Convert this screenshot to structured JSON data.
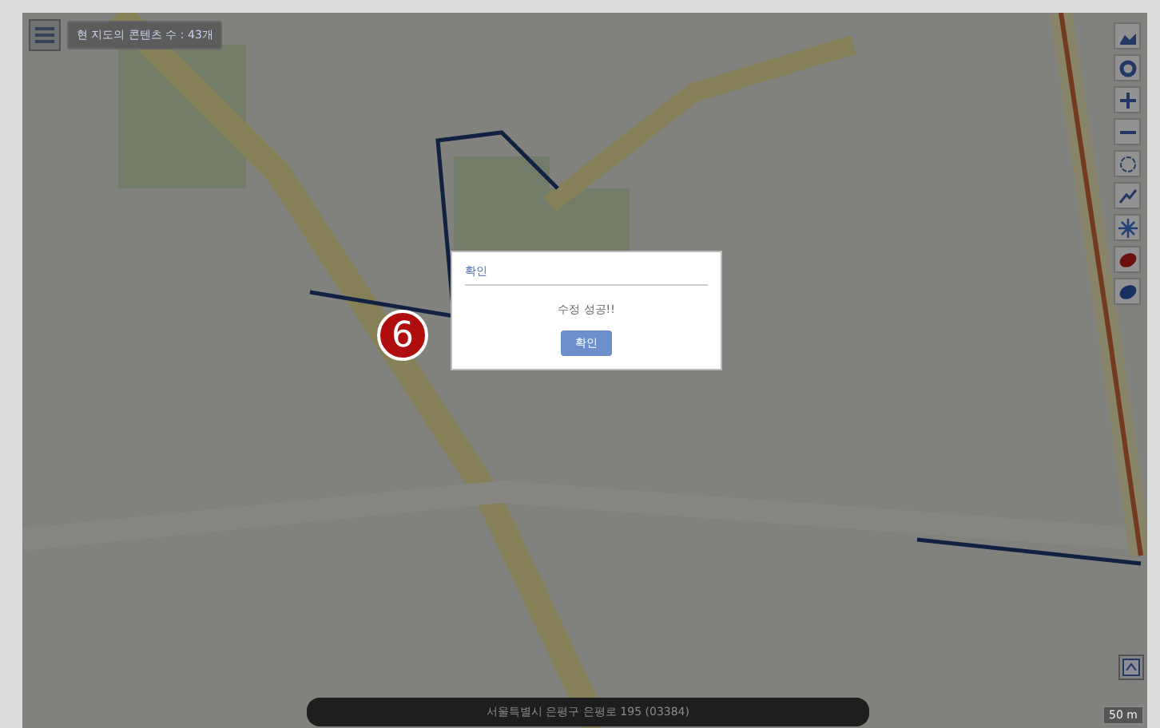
{
  "map_header": {
    "content_count": "현 지도의 콘텐츠 수 : 43개"
  },
  "marker_badge": "6",
  "dialog": {
    "title": "확인",
    "message": "수정 성공!!",
    "button": "확인"
  },
  "address_bar": "서울특별시 은평구 은평로 195 (03384)",
  "scale": "50 m"
}
